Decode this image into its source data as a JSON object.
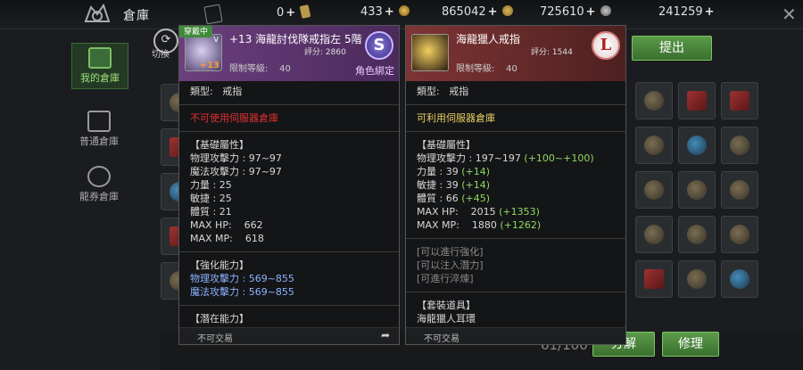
{
  "topbar": {
    "title": "倉庫",
    "currencies": [
      {
        "value": "0",
        "plus": "+"
      },
      {
        "value": "433",
        "plus": "+"
      },
      {
        "value": "865042",
        "plus": "+"
      },
      {
        "value": "725610",
        "plus": "+"
      },
      {
        "value": "241259",
        "plus": "+"
      }
    ]
  },
  "nav": {
    "swap_label": "切換",
    "items": [
      "我的倉庫",
      "普通倉庫",
      "龍券倉庫"
    ]
  },
  "buttons": {
    "withdraw": "提出",
    "disassemble": "分解",
    "repair": "修理"
  },
  "storage_count": "61/100",
  "panel_left": {
    "equipped_tag": "穿戴中",
    "icon_grade": "V",
    "icon_plus": "+13",
    "name": "+13 海龍討伐隊戒指左 5階",
    "score_label": "評分:",
    "score": "2860",
    "level_label": "限制等級:",
    "level": "40",
    "bind": "角色綁定",
    "grade": "S",
    "type_label": "類型:",
    "type": "戒指",
    "server_note": "不可使用伺服器倉庫",
    "base_header": "【基礎屬性】",
    "base_stats": [
      "物理攻擊力 : 97~97",
      "魔法攻擊力 : 97~97",
      "力量 : 25",
      "敏捷 : 25",
      "體質 : 21",
      "MAX HP:    662",
      "MAX MP:    618"
    ],
    "enhance_header": "【強化能力】",
    "enhance_stats": [
      "物理攻擊力 : 569~855",
      "魔法攻擊力 : 569~855"
    ],
    "potential_header": "【潛在能力】",
    "trade": "不可交易"
  },
  "panel_right": {
    "name": "海龍獵人戒指",
    "score_label": "評分:",
    "score": "1544",
    "level_label": "限制等級:",
    "level": "40",
    "grade": "L",
    "type_label": "類型:",
    "type": "戒指",
    "server_note": "可利用伺服器倉庫",
    "base_header": "【基礎屬性】",
    "base_stats": [
      {
        "base": "物理攻擊力 : 197~197",
        "diff": "(+100~+100)"
      },
      {
        "base": "力量 : 39",
        "diff": "(+14)"
      },
      {
        "base": "敏捷 : 39",
        "diff": "(+14)"
      },
      {
        "base": "體質 : 66",
        "diff": "(+45)"
      },
      {
        "base": "MAX HP:    2015",
        "diff": "(+1353)"
      },
      {
        "base": "MAX MP:    1880",
        "diff": "(+1262)"
      }
    ],
    "notes": [
      "[可以進行強化]",
      "[可以注入潛力]",
      "[可進行淬煉]"
    ],
    "set_header": "【套裝道具】",
    "set_items": [
      "海龍獵人耳環"
    ],
    "trade": "不可交易"
  }
}
